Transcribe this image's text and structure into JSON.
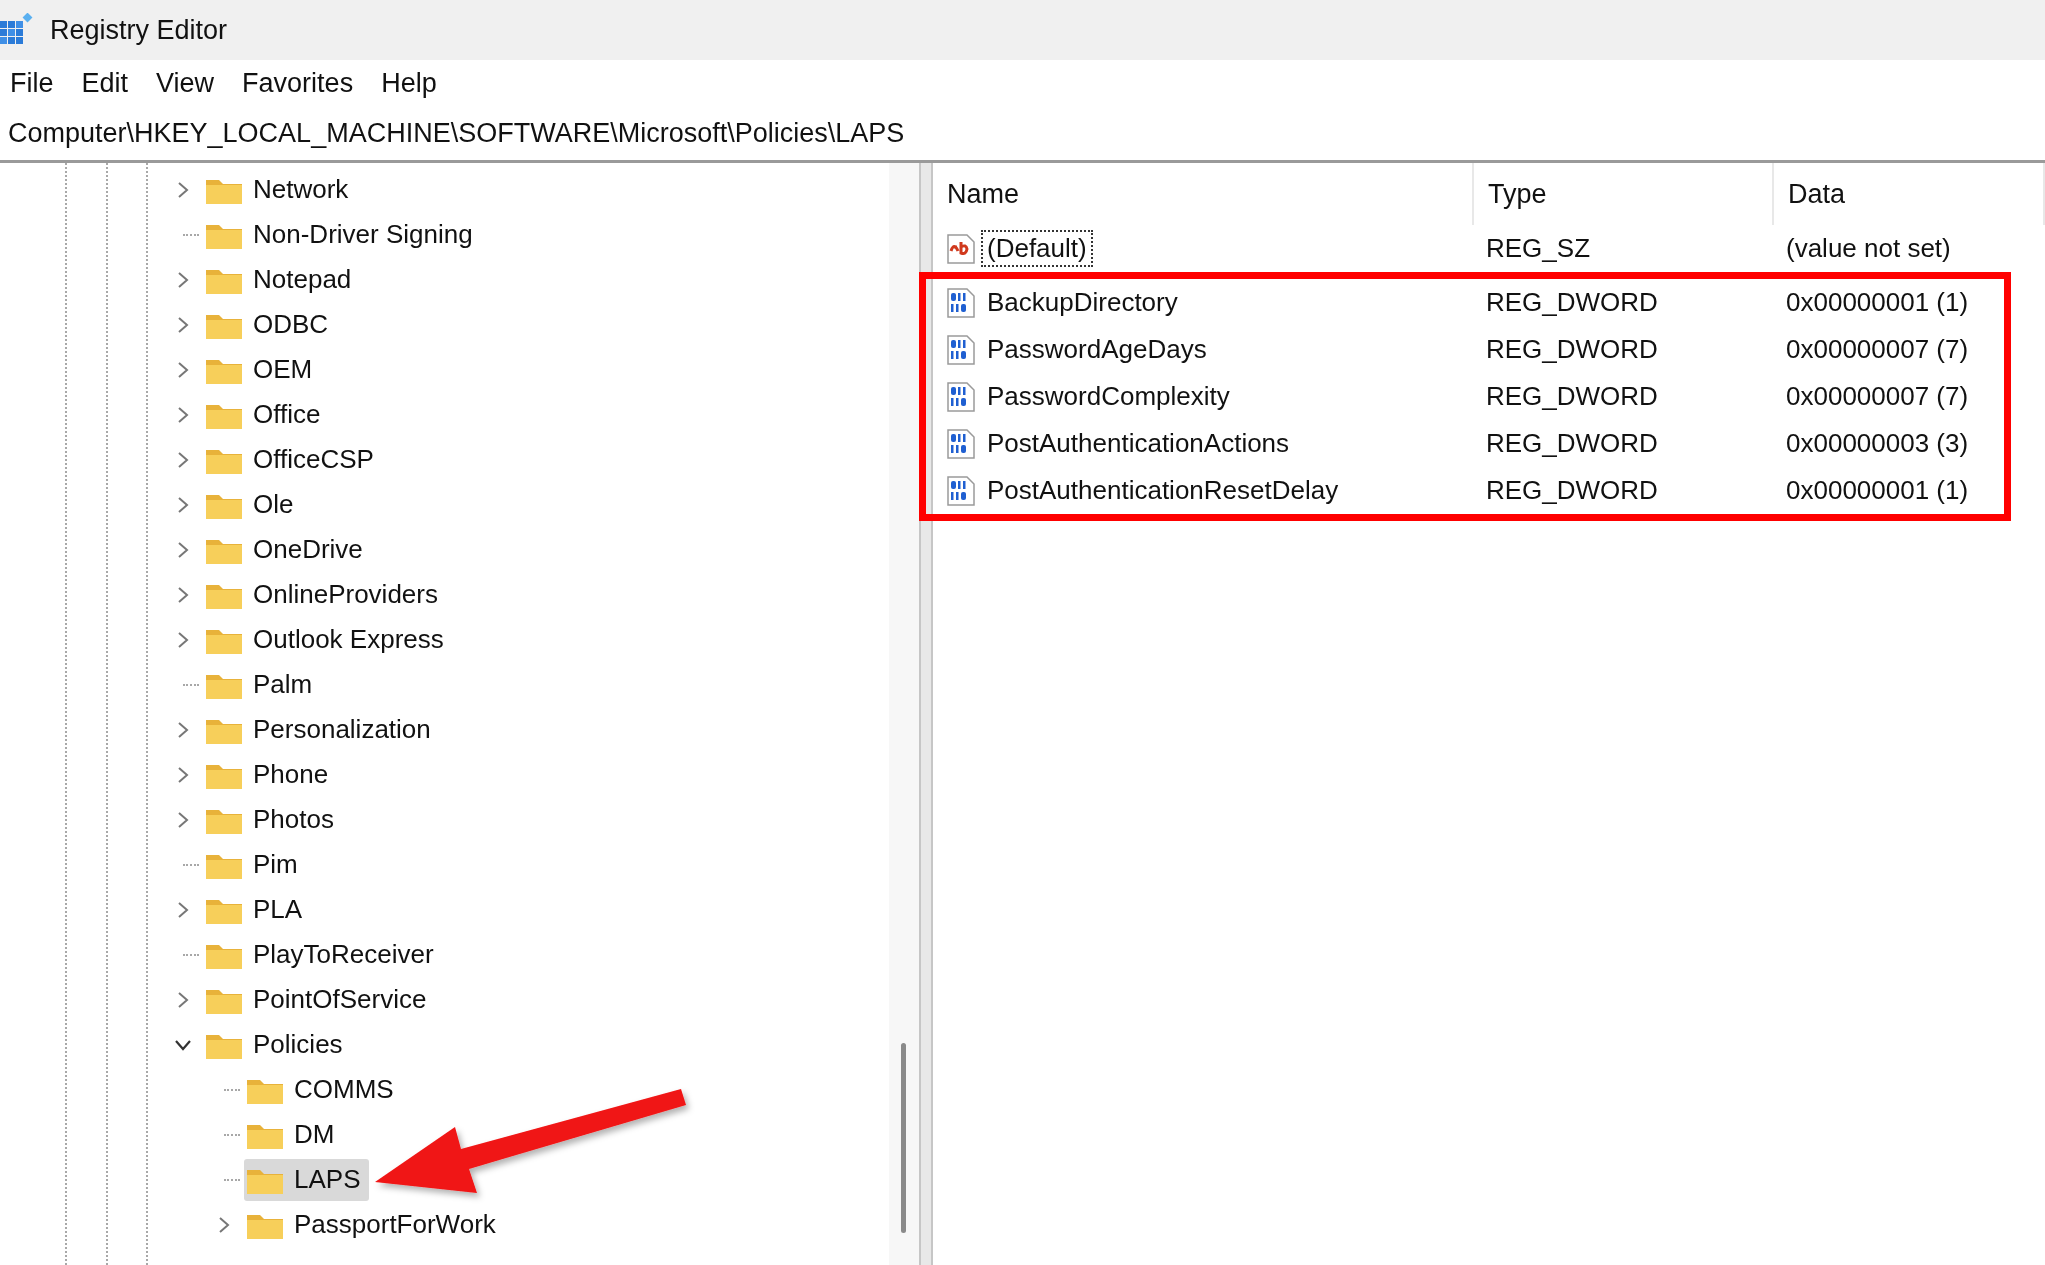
{
  "window": {
    "title": "Registry Editor"
  },
  "menu": [
    "File",
    "Edit",
    "View",
    "Favorites",
    "Help"
  ],
  "address": "Computer\\HKEY_LOCAL_MACHINE\\SOFTWARE\\Microsoft\\Policies\\LAPS",
  "tree": [
    {
      "label": "Network",
      "expandable": true,
      "expanded": false,
      "selected": false
    },
    {
      "label": "Non-Driver Signing",
      "expandable": false,
      "expanded": false,
      "selected": false
    },
    {
      "label": "Notepad",
      "expandable": true,
      "expanded": false,
      "selected": false
    },
    {
      "label": "ODBC",
      "expandable": true,
      "expanded": false,
      "selected": false
    },
    {
      "label": "OEM",
      "expandable": true,
      "expanded": false,
      "selected": false
    },
    {
      "label": "Office",
      "expandable": true,
      "expanded": false,
      "selected": false
    },
    {
      "label": "OfficeCSP",
      "expandable": true,
      "expanded": false,
      "selected": false
    },
    {
      "label": "Ole",
      "expandable": true,
      "expanded": false,
      "selected": false
    },
    {
      "label": "OneDrive",
      "expandable": true,
      "expanded": false,
      "selected": false
    },
    {
      "label": "OnlineProviders",
      "expandable": true,
      "expanded": false,
      "selected": false
    },
    {
      "label": "Outlook Express",
      "expandable": true,
      "expanded": false,
      "selected": false
    },
    {
      "label": "Palm",
      "expandable": false,
      "expanded": false,
      "selected": false
    },
    {
      "label": "Personalization",
      "expandable": true,
      "expanded": false,
      "selected": false
    },
    {
      "label": "Phone",
      "expandable": true,
      "expanded": false,
      "selected": false
    },
    {
      "label": "Photos",
      "expandable": true,
      "expanded": false,
      "selected": false
    },
    {
      "label": "Pim",
      "expandable": false,
      "expanded": false,
      "selected": false
    },
    {
      "label": "PLA",
      "expandable": true,
      "expanded": false,
      "selected": false
    },
    {
      "label": "PlayToReceiver",
      "expandable": false,
      "expanded": false,
      "selected": false
    },
    {
      "label": "PointOfService",
      "expandable": true,
      "expanded": false,
      "selected": false
    },
    {
      "label": "Policies",
      "expandable": true,
      "expanded": true,
      "selected": false,
      "children": [
        {
          "label": "COMMS",
          "expandable": false,
          "expanded": false,
          "selected": false
        },
        {
          "label": "DM",
          "expandable": false,
          "expanded": false,
          "selected": false
        },
        {
          "label": "LAPS",
          "expandable": false,
          "expanded": false,
          "selected": true,
          "arrow": true
        },
        {
          "label": "PassportForWork",
          "expandable": true,
          "expanded": false,
          "selected": false
        }
      ]
    }
  ],
  "values": {
    "columns": [
      "Name",
      "Type",
      "Data"
    ],
    "rows": [
      {
        "kind": "string",
        "name": "(Default)",
        "type": "REG_SZ",
        "data": "(value not set)",
        "focused": true,
        "highlighted": false
      },
      {
        "kind": "dword",
        "name": "BackupDirectory",
        "type": "REG_DWORD",
        "data": "0x00000001 (1)",
        "focused": false,
        "highlighted": true
      },
      {
        "kind": "dword",
        "name": "PasswordAgeDays",
        "type": "REG_DWORD",
        "data": "0x00000007 (7)",
        "focused": false,
        "highlighted": true
      },
      {
        "kind": "dword",
        "name": "PasswordComplexity",
        "type": "REG_DWORD",
        "data": "0x00000007 (7)",
        "focused": false,
        "highlighted": true
      },
      {
        "kind": "dword",
        "name": "PostAuthenticationActions",
        "type": "REG_DWORD",
        "data": "0x00000003 (3)",
        "focused": false,
        "highlighted": true
      },
      {
        "kind": "dword",
        "name": "PostAuthenticationResetDelay",
        "type": "REG_DWORD",
        "data": "0x00000001 (1)",
        "focused": false,
        "highlighted": true
      }
    ]
  }
}
